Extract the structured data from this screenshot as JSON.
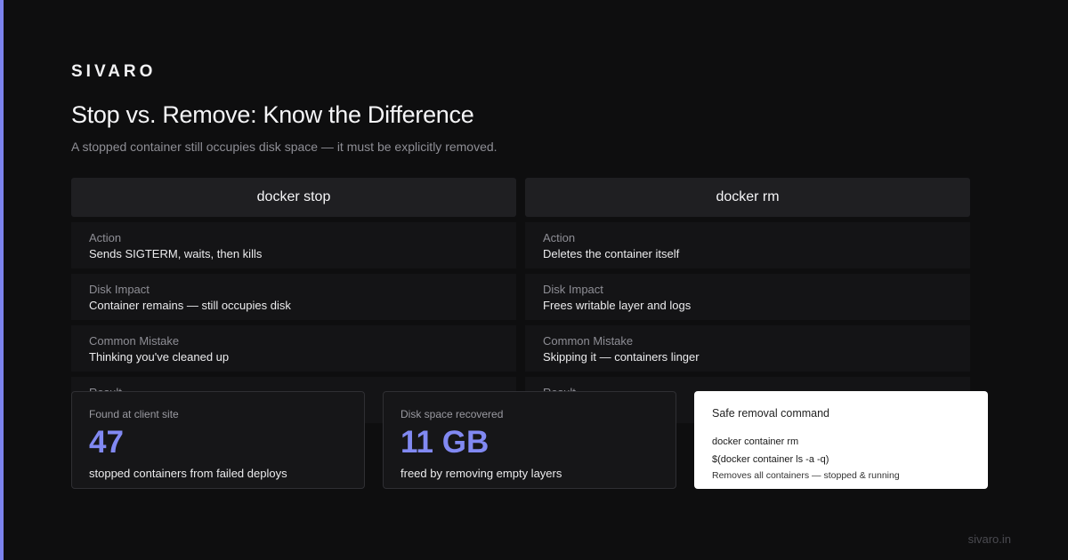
{
  "brand": "SIVARO",
  "title": "Stop vs. Remove: Know the Difference",
  "subtitle": "A stopped container still occupies disk space — it must be explicitly removed.",
  "columns": [
    {
      "header": "docker stop",
      "rows": [
        {
          "label": "Action",
          "value": "Sends SIGTERM, waits, then kills"
        },
        {
          "label": "Disk Impact",
          "value": "Container remains — still occupies disk"
        },
        {
          "label": "Common Mistake",
          "value": "Thinking you've cleaned up"
        },
        {
          "label": "Result",
          "value": ""
        }
      ]
    },
    {
      "header": "docker rm",
      "rows": [
        {
          "label": "Action",
          "value": "Deletes the container itself"
        },
        {
          "label": "Disk Impact",
          "value": "Frees writable layer and logs"
        },
        {
          "label": "Common Mistake",
          "value": "Skipping it — containers linger"
        },
        {
          "label": "Result",
          "value": ""
        }
      ]
    }
  ],
  "stats": [
    {
      "label": "Found at client site",
      "number": "47",
      "caption": "stopped containers from failed deploys"
    },
    {
      "label": "Disk space recovered",
      "number": "11 GB",
      "caption": "freed by removing empty layers"
    }
  ],
  "command_card": {
    "title": "Safe removal command",
    "line1": "docker container rm",
    "line2": "$(docker container ls -a -q)",
    "note": "Removes all containers — stopped & running"
  },
  "footer": "sivaro.in",
  "colors": {
    "accent": "#7c83ee",
    "stat_number": "#8189f2",
    "background": "#0e0e0f"
  }
}
